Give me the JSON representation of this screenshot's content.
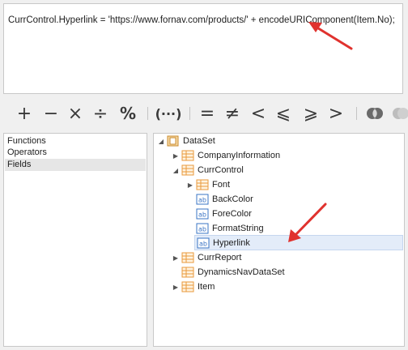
{
  "expression": {
    "text": "CurrControl.Hyperlink = 'https://www.fornav.com/products/' + encodeURIComponent(Item.No);"
  },
  "operators": {
    "plus": "+",
    "minus": "−",
    "multiply": "×",
    "divide": "÷",
    "percent": "%",
    "parens": "(···)",
    "equal": "=",
    "not_equal": "≠",
    "less": "<",
    "less_equal": "⩽",
    "greater_equal": "⩾",
    "greater": ">"
  },
  "categories": [
    "Functions",
    "Operators",
    "Fields"
  ],
  "selected_category": "Fields",
  "tree": {
    "root": "DataSet",
    "nodes": [
      {
        "label": "CompanyInformation",
        "icon": "table-icon",
        "expanded": false
      },
      {
        "label": "CurrControl",
        "icon": "table-icon",
        "expanded": true
      },
      {
        "label": "Font",
        "icon": "table-icon",
        "expanded": false
      },
      {
        "label": "BackColor",
        "icon": "field-icon"
      },
      {
        "label": "ForeColor",
        "icon": "field-icon"
      },
      {
        "label": "FormatString",
        "icon": "field-icon"
      },
      {
        "label": "Hyperlink",
        "icon": "field-icon",
        "selected": true
      },
      {
        "label": "CurrReport",
        "icon": "table-icon",
        "expanded": false
      },
      {
        "label": "DynamicsNavDataSet",
        "icon": "table-icon"
      },
      {
        "label": "Item",
        "icon": "table-icon",
        "expanded": false
      }
    ]
  },
  "colors": {
    "annotation_arrow": "#e0322e",
    "selection": "#e3ecf9",
    "table_icon": "#e89a3c",
    "field_icon": "#3a74c4"
  }
}
